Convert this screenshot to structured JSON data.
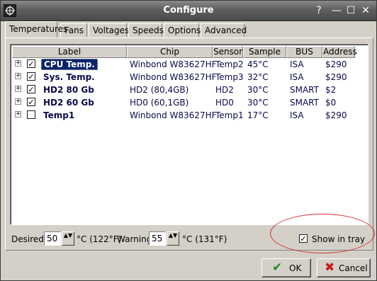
{
  "window": {
    "title": "Configure",
    "controls": {
      "help": "?",
      "minimize": "—",
      "maximize": "☐",
      "close": "✕"
    }
  },
  "tabs": [
    {
      "label": "Temperatures",
      "active": true
    },
    {
      "label": "Fans"
    },
    {
      "label": "Voltages"
    },
    {
      "label": "Speeds"
    },
    {
      "label": "Options"
    },
    {
      "label": "Advanced"
    }
  ],
  "list": {
    "columns": [
      "Label",
      "Chip",
      "Sensor",
      "Sample",
      "BUS",
      "Address"
    ],
    "rows": [
      {
        "expander": "+",
        "checked": true,
        "check": "✓",
        "label": "CPU Temp.",
        "chip": "Winbond W83627HF",
        "sensor": "Temp2",
        "sample": "45°C",
        "bus": "ISA",
        "address": "$290",
        "selected": true
      },
      {
        "expander": "+",
        "checked": true,
        "check": "✓",
        "label": "Sys. Temp.",
        "chip": "Winbond W83627HF",
        "sensor": "Temp3",
        "sample": "32°C",
        "bus": "ISA",
        "address": "$290"
      },
      {
        "expander": "+",
        "checked": true,
        "check": "✓",
        "label": "HD2 80 Gb",
        "chip": "HD2 (80,4GB)",
        "sensor": "HD2",
        "sample": "30°C",
        "bus": "SMART",
        "address": "$2"
      },
      {
        "expander": "+",
        "checked": true,
        "check": "✓",
        "label": "HD2 60 Gb",
        "chip": "HD0 (60,1GB)",
        "sensor": "HD0",
        "sample": "30°C",
        "bus": "SMART",
        "address": "$0"
      },
      {
        "expander": "+",
        "checked": false,
        "check": "",
        "label": "Temp1",
        "chip": "Winbond W83627HF",
        "sensor": "Temp1",
        "sample": "17°C",
        "bus": "ISA",
        "address": "$290"
      }
    ]
  },
  "settings": {
    "desired_label": "Desired",
    "desired_value": "50",
    "desired_unit": "°C (122°F)",
    "warning_label": "Warning",
    "warning_value": "55",
    "warning_unit": "°C (131°F)",
    "spin_glyph": "▲▼",
    "tray_checked": true,
    "tray_check": "✓",
    "tray_label": "Show in tray",
    "highlight_color": "#d23030"
  },
  "buttons": {
    "ok": {
      "icon": "✔",
      "label": "OK",
      "icon_color": "#1f8a1f"
    },
    "cancel": {
      "icon": "✖",
      "label": "Cancel",
      "icon_color": "#c81e1e"
    }
  }
}
